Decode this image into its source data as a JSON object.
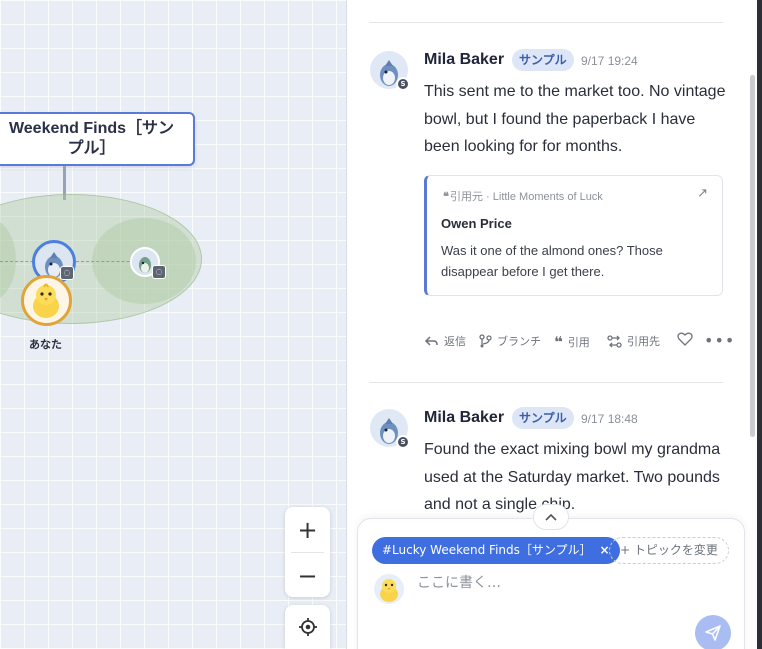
{
  "canvas": {
    "topic_node_title": "Weekend Finds［サンプル］",
    "you_label": "あなた",
    "zoom_in_label": "+",
    "zoom_out_label": "−"
  },
  "messages": [
    {
      "author": "Mila Baker",
      "tag": "サンプル",
      "time": "9/17 19:24",
      "text": "This sent me to the market too. No vintage bowl, but I found the paperback I have been looking for for months.",
      "quote": {
        "source_label": "引用元 · Little Moments of Luck",
        "author": "Owen Price",
        "text": "Was it one of the almond ones? Those disappear before I get there."
      },
      "actions": {
        "reply": "返信",
        "branch": "ブランチ",
        "quote": "引用",
        "quoted_by": "引用先"
      }
    },
    {
      "author": "Mila Baker",
      "tag": "サンプル",
      "time": "9/17 18:48",
      "text": "Found the exact mixing bowl my grandma used at the Saturday market. Two pounds and not a single chip."
    }
  ],
  "composer": {
    "topic_chip": "#Lucky Weekend Finds［サンプル］",
    "chip_close": "×",
    "change_topic": "+ トピックを変更",
    "placeholder": "ここに書く…"
  },
  "colors": {
    "accent": "#3f6ee0",
    "tag_bg": "#dde6f7",
    "send_disabled": "#a9bdf3"
  }
}
